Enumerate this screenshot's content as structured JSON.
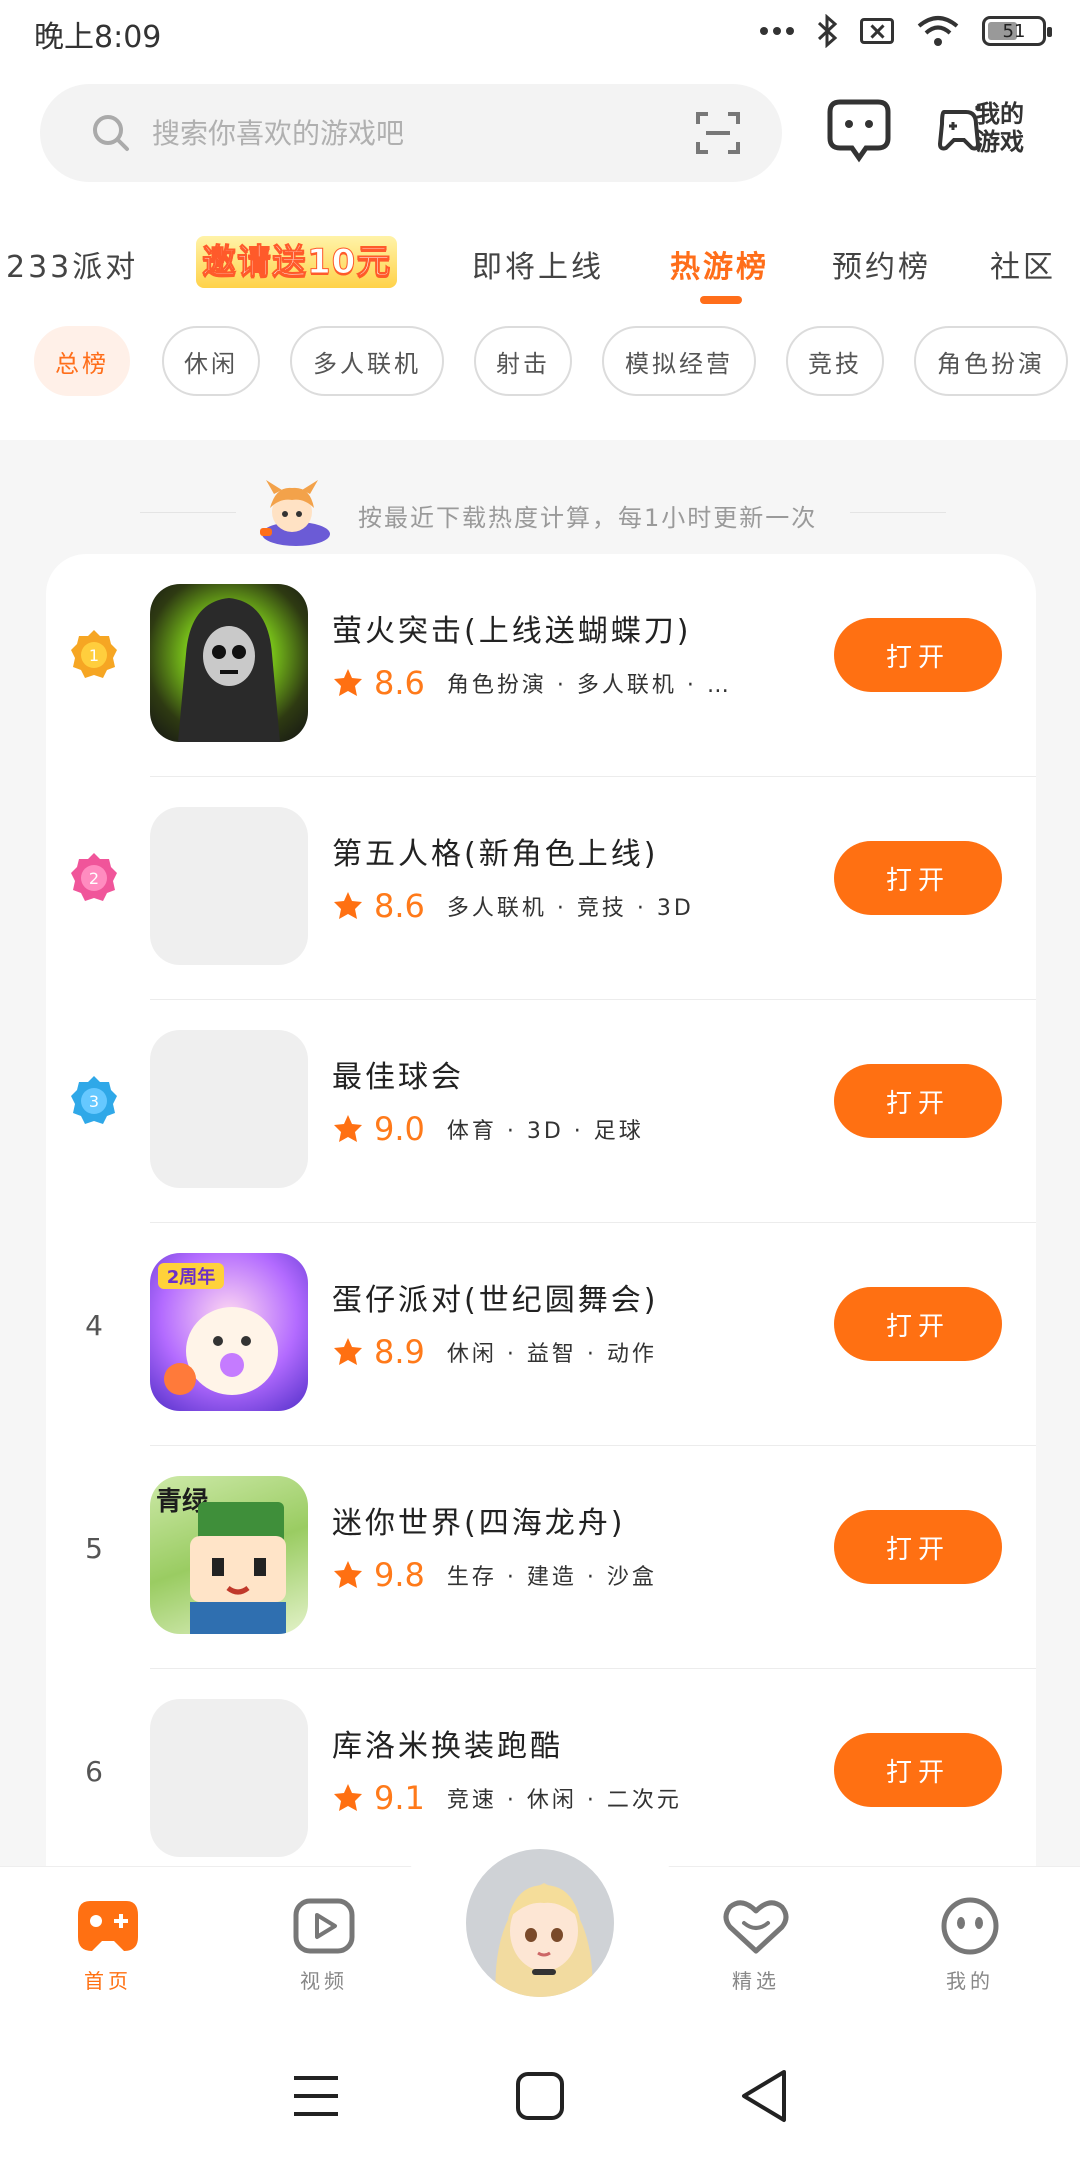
{
  "status_bar": {
    "time": "晚上8:09",
    "battery": "51"
  },
  "search": {
    "placeholder": "搜索你喜欢的游戏吧"
  },
  "header": {
    "my_games_label": "我的\n游戏"
  },
  "tabs": [
    {
      "label": "233派对"
    },
    {
      "label": "邀请送10元",
      "promo": true
    },
    {
      "label": "即将上线"
    },
    {
      "label": "热游榜",
      "active": true
    },
    {
      "label": "预约榜"
    },
    {
      "label": "社区"
    }
  ],
  "chips": [
    {
      "label": "总榜",
      "active": true
    },
    {
      "label": "休闲"
    },
    {
      "label": "多人联机"
    },
    {
      "label": "射击"
    },
    {
      "label": "模拟经营"
    },
    {
      "label": "竞技"
    },
    {
      "label": "角色扮演"
    }
  ],
  "notice": "按最近下载热度计算，每1小时更新一次",
  "games": [
    {
      "rank": "1",
      "title": "萤火突击(上线送蝴蝶刀)",
      "score": "8.6",
      "tags": "角色扮演 · 多人联机 · …",
      "button": "打开"
    },
    {
      "rank": "2",
      "title": "第五人格(新角色上线)",
      "score": "8.6",
      "tags": "多人联机 · 竞技 · 3D",
      "button": "打开"
    },
    {
      "rank": "3",
      "title": "最佳球会",
      "score": "9.0",
      "tags": "体育 · 3D · 足球",
      "button": "打开"
    },
    {
      "rank": "4",
      "title": "蛋仔派对(世纪圆舞会)",
      "score": "8.9",
      "tags": "休闲 · 益智 · 动作",
      "button": "打开"
    },
    {
      "rank": "5",
      "title": "迷你世界(四海龙舟)",
      "score": "9.8",
      "tags": "生存 · 建造 · 沙盒",
      "button": "打开"
    },
    {
      "rank": "6",
      "title": "库洛米换装跑酷",
      "score": "9.1",
      "tags": "竞速 · 休闲 · 二次元",
      "button": "打开"
    }
  ],
  "bottom_nav": [
    {
      "label": "首页",
      "active": true
    },
    {
      "label": "视频"
    },
    {
      "label": "精选"
    },
    {
      "label": "我的"
    }
  ],
  "colors": {
    "accent": "#ff7012",
    "chip_active_bg": "#fff0e8"
  }
}
